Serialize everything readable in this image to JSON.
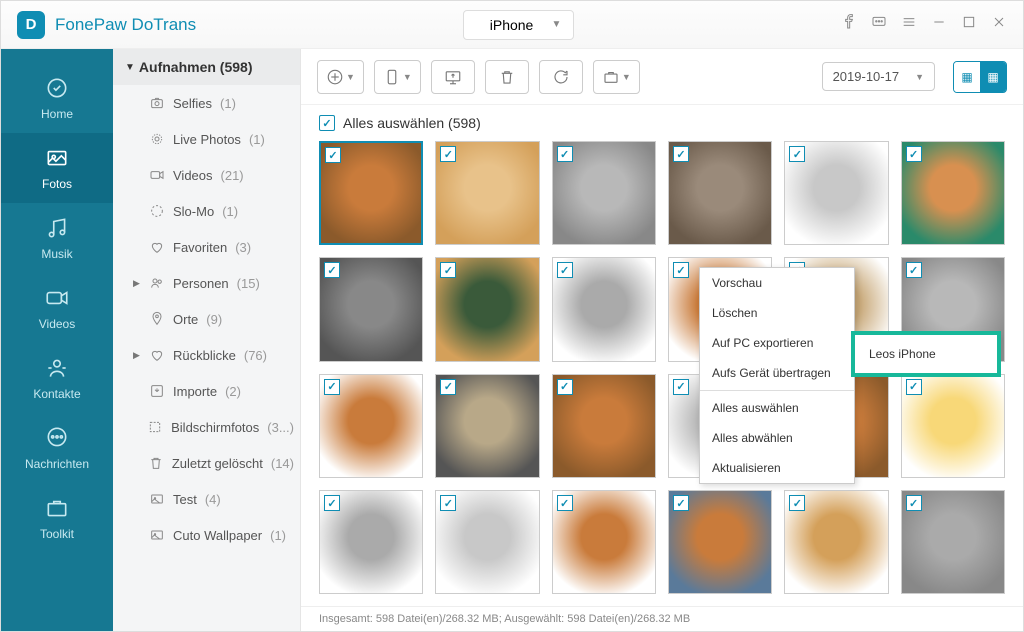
{
  "app_name": "FonePaw DoTrans",
  "device": "iPhone",
  "nav": [
    {
      "label": "Home",
      "key": "home"
    },
    {
      "label": "Fotos",
      "key": "fotos",
      "active": true
    },
    {
      "label": "Musik",
      "key": "musik"
    },
    {
      "label": "Videos",
      "key": "videos"
    },
    {
      "label": "Kontakte",
      "key": "kontakte"
    },
    {
      "label": "Nachrichten",
      "key": "nachrichten"
    },
    {
      "label": "Toolkit",
      "key": "toolkit"
    }
  ],
  "albums_header": "Aufnahmen (598)",
  "albums": [
    {
      "icon": "camera",
      "label": "Selfies",
      "count": "(1)"
    },
    {
      "icon": "live",
      "label": "Live Photos",
      "count": "(1)"
    },
    {
      "icon": "video",
      "label": "Videos",
      "count": "(21)"
    },
    {
      "icon": "slomo",
      "label": "Slo-Mo",
      "count": "(1)"
    },
    {
      "icon": "heart",
      "label": "Favoriten",
      "count": "(3)"
    },
    {
      "icon": "people",
      "label": "Personen",
      "count": "(15)",
      "expandable": true
    },
    {
      "icon": "pin",
      "label": "Orte",
      "count": "(9)"
    },
    {
      "icon": "memories",
      "label": "Rückblicke",
      "count": "(76)",
      "expandable": true
    },
    {
      "icon": "import",
      "label": "Importe",
      "count": "(2)"
    },
    {
      "icon": "screenshot",
      "label": "Bildschirmfotos",
      "count": "(3...)"
    },
    {
      "icon": "trash",
      "label": "Zuletzt gelöscht",
      "count": "(14)"
    },
    {
      "icon": "folder",
      "label": "Test",
      "count": "(4)"
    },
    {
      "icon": "folder",
      "label": "Cuto Wallpaper",
      "count": "(1)"
    }
  ],
  "date": "2019-10-17",
  "select_all_label": "Alles auswählen (598)",
  "context_menu": [
    {
      "label": "Vorschau"
    },
    {
      "label": "Löschen"
    },
    {
      "label": "Auf PC exportieren"
    },
    {
      "label": "Aufs Gerät übertragen",
      "submenu": true
    },
    {
      "sep": true
    },
    {
      "label": "Alles auswählen"
    },
    {
      "label": "Alles abwählen"
    },
    {
      "label": "Aktualisieren"
    }
  ],
  "submenu_label": "Leos iPhone",
  "status": "Insgesamt: 598 Datei(en)/268.32 MB; Ausgewählt: 598 Datei(en)/268.32 MB",
  "thumbs": [
    {
      "c1": "#c97b3b",
      "c2": "#8b5a2b",
      "sel": true
    },
    {
      "c1": "#e8c28a",
      "c2": "#d4a05a"
    },
    {
      "c1": "#b8b8b8",
      "c2": "#888"
    },
    {
      "c1": "#9a8a7a",
      "c2": "#6a5a4a"
    },
    {
      "c1": "#c8c8c8",
      "c2": "#fff"
    },
    {
      "c1": "#d89050",
      "c2": "#2a8a6a"
    },
    {
      "c1": "#888",
      "c2": "#555"
    },
    {
      "c1": "#3a5a3a",
      "c2": "#d4a05a"
    },
    {
      "c1": "#aaa",
      "c2": "#fff"
    },
    {
      "c1": "#c97b3b",
      "c2": "#fff"
    },
    {
      "c1": "#c8a878",
      "c2": "#fff"
    },
    {
      "c1": "#b8b8b8",
      "c2": "#888"
    },
    {
      "c1": "#c97b3b",
      "c2": "#fff"
    },
    {
      "c1": "#b8a888",
      "c2": "#555"
    },
    {
      "c1": "#c97b3b",
      "c2": "#8b5a2b"
    },
    {
      "c1": "#b8b8b8",
      "c2": "#fff"
    },
    {
      "c1": "#c97b3b",
      "c2": "#8b5a2b"
    },
    {
      "c1": "#f8d878",
      "c2": "#fff"
    },
    {
      "c1": "#aaa",
      "c2": "#fff"
    },
    {
      "c1": "#c8c8c8",
      "c2": "#fff"
    },
    {
      "c1": "#c97b3b",
      "c2": "#fff"
    },
    {
      "c1": "#c97b3b",
      "c2": "#5a7a9a"
    },
    {
      "c1": "#d4a05a",
      "c2": "#fff"
    },
    {
      "c1": "#aaa",
      "c2": "#888"
    }
  ]
}
